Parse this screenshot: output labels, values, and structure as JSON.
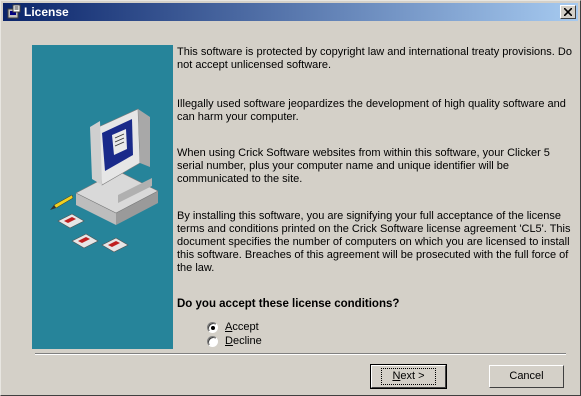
{
  "window": {
    "title": "License",
    "close_glyph": "close-icon",
    "app_icon": "license-app-icon"
  },
  "license": {
    "paragraphs": [
      "This software is protected by copyright law and international treaty provisions.  Do not accept unlicensed software.",
      "Illegally used software jeopardizes the development of high quality software and can harm your computer.",
      "When using Crick Software websites from within this software, your Clicker 5 serial number, plus your computer name and unique identifier will be communicated to the site.",
      "By installing this software, you are signifying your full acceptance of the license terms and conditions printed on the Crick Software license agreement 'CL5'.  This document specifies the number of computers on which you are licensed to install this software. Breaches of this agreement will be prosecuted with the full force of the law."
    ],
    "question": "Do you accept these license conditions?",
    "options": [
      {
        "key": "A",
        "rest": "ccept",
        "selected": true
      },
      {
        "key": "D",
        "rest": "ecline",
        "selected": false
      }
    ]
  },
  "buttons": {
    "next_key": "N",
    "next_rest": "ext >",
    "cancel": "Cancel"
  },
  "colors": {
    "panel": "#26849a",
    "face": "#d4d0c8",
    "title_start": "#0a246a"
  }
}
